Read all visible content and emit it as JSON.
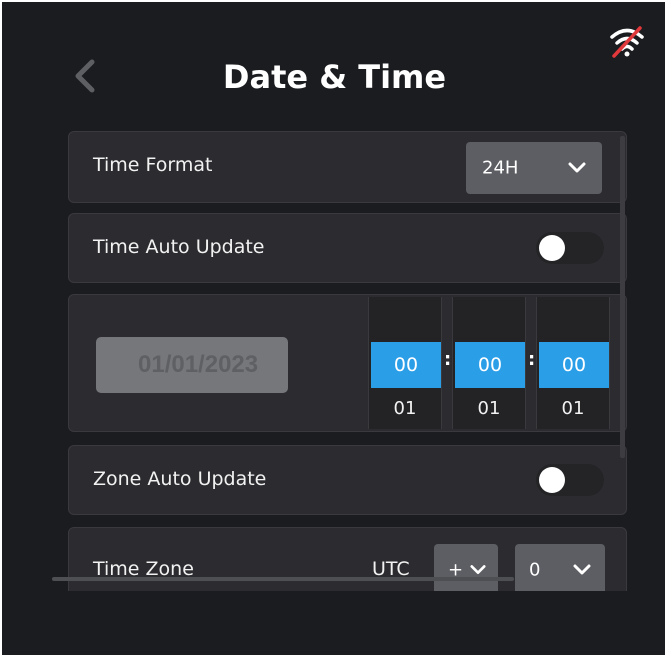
{
  "header": {
    "title": "Date & Time",
    "back_icon": "chevron-left-icon",
    "status_icon": "wifi-off-icon"
  },
  "rows": {
    "time_format": {
      "label": "Time Format",
      "value": "24H"
    },
    "time_auto_update": {
      "label": "Time Auto Update",
      "enabled": false
    },
    "date_time": {
      "date": "01/01/2023",
      "hour": {
        "selected": "00",
        "next": "01"
      },
      "minute": {
        "selected": "00",
        "next": "01"
      },
      "second": {
        "selected": "00",
        "next": "01"
      },
      "separator": ":"
    },
    "zone_auto_update": {
      "label": "Zone Auto Update",
      "enabled": false
    },
    "time_zone": {
      "label": "Time Zone",
      "prefix": "UTC",
      "sign": "+",
      "offset": "0"
    }
  },
  "colors": {
    "background": "#1b1c1f",
    "row_background": "#2c2c30",
    "accent": "#2b9ee8",
    "wifi_slash": "#e0383b"
  }
}
